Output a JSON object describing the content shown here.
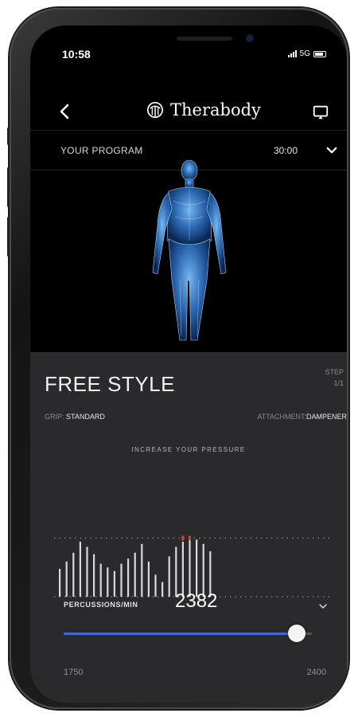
{
  "status_bar": {
    "time": "10:58",
    "network": "5G"
  },
  "nav": {
    "brand": "Therabody",
    "icons": [
      "back-icon",
      "therabody-logo-icon",
      "cast-icon"
    ]
  },
  "program": {
    "label": "YOUR PROGRAM",
    "duration": "30:00",
    "chevron": "chevron-down-icon"
  },
  "session": {
    "mode": "FREE STYLE",
    "step_label": "STEP",
    "step_value": "1/1",
    "grip_label": "GRIP:",
    "grip_value": "STANDARD",
    "attachment_label": "ATTACHMENT:",
    "attachment_value": "DAMPENER",
    "instruction": "INCREASE YOUR PRESSURE"
  },
  "pressure_chart": {
    "bars": [
      0.38,
      0.48,
      0.6,
      0.75,
      0.68,
      0.58,
      0.45,
      0.4,
      0.35,
      0.45,
      0.52,
      0.6,
      0.72,
      0.48,
      0.3,
      0.2,
      0.55,
      0.68,
      0.75,
      0.8,
      0.78,
      0.72,
      0.62
    ],
    "target_level": 0.8,
    "baseline_level": 0.0,
    "indicator_color": "#d83a3a"
  },
  "percussions": {
    "label": "PERCUSSIONS/MIN",
    "value": "2382",
    "min": "1750",
    "max": "2400",
    "current": 2382,
    "min_num": 1750,
    "max_num": 2400
  },
  "colors": {
    "accent": "#3c6ad6",
    "panel": "#2a2a2c",
    "figure": "#4aa3ff"
  }
}
